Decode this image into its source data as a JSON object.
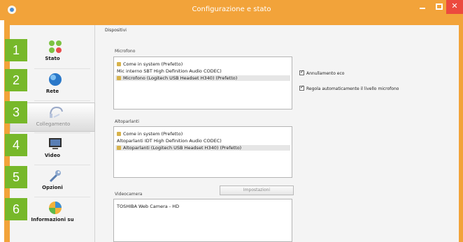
{
  "window": {
    "title": "Configurazione e stato",
    "close_glyph": "✕"
  },
  "sidebar": {
    "items": [
      {
        "badge": "1",
        "label": "Stato",
        "icon": "status-icon"
      },
      {
        "badge": "2",
        "label": "Rete",
        "icon": "network-globe-icon"
      },
      {
        "badge": "3",
        "label": "Collegamento",
        "icon": "headset-icon"
      },
      {
        "badge": "4",
        "label": "Video",
        "icon": "monitor-icon"
      },
      {
        "badge": "5",
        "label": "Opzioni",
        "icon": "wrench-icon"
      },
      {
        "badge": "6",
        "label": "Informazioni su",
        "icon": "info-icon"
      }
    ]
  },
  "main": {
    "section_title": "Dispositivi",
    "microphone": {
      "label": "Microfono",
      "items": [
        "Come in system (Prefetto)",
        "Mic interno SBT High Definition Audio CODEC)",
        "Microfono (Logitech USB Headset H340) (Prefetto)"
      ]
    },
    "options": {
      "auto_gain": "Annullamento eco",
      "auto_adjust": "Regola automaticamente il livello microfono"
    },
    "speakers": {
      "label": "Altoparlanti",
      "items": [
        "Come in system (Prefetto)",
        "Altoparlanti IDT High Definition Audio CODEC)",
        "Altoparlanti (Logitech USB Headset H340) (Prefetto)"
      ]
    },
    "camera": {
      "label": "Videocamera",
      "button": "Impostazioni",
      "items": [
        "TOSHIBA Web Camera - HD"
      ]
    }
  },
  "colors": {
    "titlebar": "#f2a33a",
    "badge": "#77b82a",
    "close": "#ec4a3e"
  }
}
